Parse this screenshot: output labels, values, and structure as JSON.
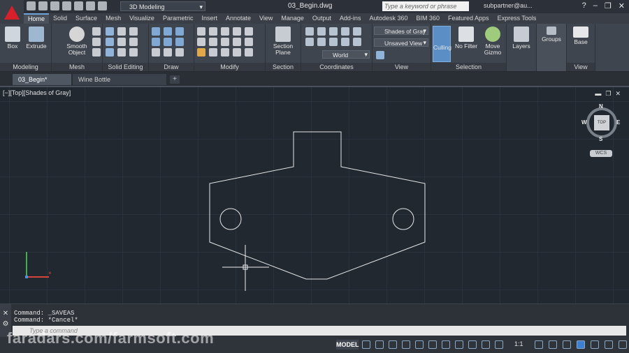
{
  "titlebar": {
    "workspace": "3D Modeling",
    "filename": "03_Begin.dwg",
    "search_placeholder": "Type a keyword or phrase",
    "user": "subpartner@au..."
  },
  "ribbon_tabs": [
    "Home",
    "Solid",
    "Surface",
    "Mesh",
    "Visualize",
    "Parametric",
    "Insert",
    "Annotate",
    "View",
    "Manage",
    "Output",
    "Add-ins",
    "Autodesk 360",
    "BIM 360",
    "Featured Apps",
    "Express Tools"
  ],
  "panels": {
    "modeling": "Modeling",
    "mesh": "Mesh",
    "solid_editing": "Solid Editing",
    "draw": "Draw",
    "modify": "Modify",
    "section": "Section",
    "coordinates": "Coordinates",
    "view": "View",
    "selection": "Selection"
  },
  "buttons": {
    "box": "Box",
    "extrude": "Extrude",
    "smooth_object_1": "Smooth",
    "smooth_object_2": "Object",
    "section_plane_1": "Section",
    "section_plane_2": "Plane",
    "culling": "Culling",
    "no_filter": "No Filter",
    "move_gizmo_1": "Move",
    "move_gizmo_2": "Gizmo",
    "layers": "Layers",
    "groups": "Groups",
    "base": "Base"
  },
  "dropdowns": {
    "visual_style": "Shades of Gray",
    "named_view": "Unsaved View",
    "ucs": "World"
  },
  "doc_tabs": [
    "03_Begin*",
    "Wine Bottle Opener_Assembly*"
  ],
  "viewport": {
    "label": "[−][Top][Shades of Gray]",
    "cube_face": "TOP",
    "north": "N",
    "south": "S",
    "east": "E",
    "west": "W",
    "wcs": "WCS"
  },
  "command": {
    "lines": [
      "Command: _SAVEAS",
      "Command: *Cancel*"
    ],
    "placeholder": "Type a command"
  },
  "status": {
    "model": "MODEL",
    "scale": "1:1"
  },
  "watermark": "faradars.com/farmsoft.com",
  "colors": {
    "app_red": "#d8202a",
    "canvas_bg": "#212830",
    "accent_blue": "#5a8ec4"
  }
}
